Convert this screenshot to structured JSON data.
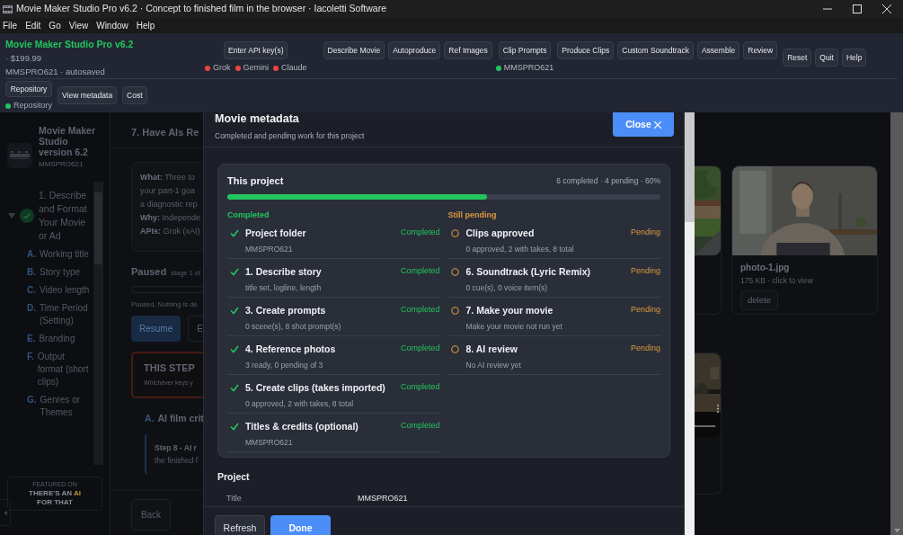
{
  "window": {
    "title": "Movie Maker Studio Pro v6.2 · Concept to finished film in the browser · Iacoletti Software"
  },
  "menu": [
    "File",
    "Edit",
    "Go",
    "View",
    "Window",
    "Help"
  ],
  "header": {
    "app_name": "Movie Maker Studio Pro v6.2",
    "price": "· $199.99",
    "project": "MMSPRO621 · autosaved",
    "api_button": "Enter API key(s)",
    "providers": [
      {
        "name": "Grok",
        "connected": false
      },
      {
        "name": "Gemini",
        "connected": false
      },
      {
        "name": "Claude",
        "connected": false
      }
    ],
    "steps": [
      {
        "label": "Describe Movie"
      },
      {
        "label": "Autoproduce"
      },
      {
        "label": "Ref Images"
      },
      {
        "label": "Clip Prompts",
        "note": {
          "text": "MMSPRO621",
          "connected": true
        }
      },
      {
        "label": "Produce Clips"
      },
      {
        "label": "Custom Soundtrack"
      },
      {
        "label": "Assemble"
      },
      {
        "label": "Review"
      }
    ],
    "actions": [
      "Reset",
      "Quit",
      "Help"
    ],
    "repository": {
      "label": "Repository",
      "status": "Repository",
      "connected": true
    },
    "tools": [
      "View metadata",
      "Cost"
    ]
  },
  "sidebar": {
    "title": "Movie Maker Studio version 6.2",
    "project": "MMSPRO621",
    "step": {
      "label": "1. Describe and Format Your Movie or Ad",
      "expanded": true,
      "done": true
    },
    "items": [
      {
        "letter": "A.",
        "label": "Working title"
      },
      {
        "letter": "B.",
        "label": "Story type"
      },
      {
        "letter": "C.",
        "label": "Video length"
      },
      {
        "letter": "D.",
        "label": "Time Period (Setting)"
      },
      {
        "letter": "E.",
        "label": "Branding"
      },
      {
        "letter": "F.",
        "label": "Output format (short clips)"
      },
      {
        "letter": "G.",
        "label": "Genres or Themes"
      }
    ],
    "featured": {
      "caption": "FEATURED ON",
      "before": "THERE'S AN",
      "highlight": "AI",
      "after": "FOR THAT"
    }
  },
  "stage": {
    "heading": "7. Have AIs Re",
    "info": [
      "**What:** Three to",
      "your part-1 goa",
      "a diagnostic rep",
      "**Why:** Independe",
      "**APIs:** Grok (xAI)"
    ],
    "status": "Paused",
    "stage": "stage 1 of",
    "message": "Paused. Nothing is de",
    "buttons": [
      "Resume",
      "E"
    ],
    "warning": {
      "title": "THIS STEP",
      "text": "Whichever keys y"
    },
    "section": {
      "letter": "A.",
      "title": "AI film crit"
    },
    "note": [
      "Step 8 - AI r",
      "the finished f"
    ],
    "back": "Back"
  },
  "gallery": {
    "photo": {
      "name": "photo-1.jpg",
      "meta": "175 KB · click to view",
      "action": "delete"
    }
  },
  "modal": {
    "title": "Movie metadata",
    "subtitle": "Completed and pending work for this project",
    "close": "Close",
    "card": {
      "title": "This project",
      "summary": "6 completed · 4 pending · 60%",
      "level": 0.6,
      "columns": [
        {
          "heading": "Completed",
          "kind": "completed",
          "items": [
            {
              "title": "Project folder",
              "detail": "MMSPRO621",
              "status": "Completed"
            },
            {
              "title": "1. Describe story",
              "detail": "title set, logline, length",
              "status": "Completed"
            },
            {
              "title": "3. Create prompts",
              "detail": "0 scene(s), 8 shot prompt(s)",
              "status": "Completed"
            },
            {
              "title": "4. Reference photos",
              "detail": "3 ready, 0 pending of 3",
              "status": "Completed"
            },
            {
              "title": "5. Create clips (takes imported)",
              "detail": "0 approved, 2 with takes, 8 total",
              "status": "Completed"
            },
            {
              "title": "Titles & credits (optional)",
              "detail": "MMSPRO621",
              "status": "Completed"
            }
          ]
        },
        {
          "heading": "Still pending",
          "kind": "pending",
          "items": [
            {
              "title": "Clips approved",
              "detail": "0 approved, 2 with takes, 8 total",
              "status": "Pending"
            },
            {
              "title": "6. Soundtrack (Lyric Remix)",
              "detail": "0 cue(s), 0 voice item(s)",
              "status": "Pending"
            },
            {
              "title": "7. Make your movie",
              "detail": "Make your movie not run yet",
              "status": "Pending"
            },
            {
              "title": "8. AI review",
              "detail": "No AI review yet",
              "status": "Pending"
            }
          ]
        }
      ]
    },
    "project": {
      "heading": "Project",
      "rows": [
        {
          "label": "Title",
          "value": "MMSPRO621"
        }
      ]
    },
    "buttons": [
      {
        "label": "Refresh",
        "primary": false
      },
      {
        "label": "Done",
        "primary": true
      }
    ]
  }
}
